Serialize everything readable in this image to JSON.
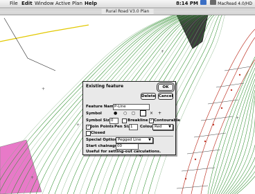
{
  "menubar": {
    "items": [
      "File",
      "Edit",
      "Window",
      "Active",
      "Plan",
      "Help"
    ],
    "clock": "8:14 PM",
    "disk_label": "MacRead 4.0/HD"
  },
  "window": {
    "title": "Rural Road V3.0 Plan"
  },
  "dialog": {
    "title": "Existing feature",
    "ok": "OK",
    "delete": "Delete",
    "cancel": "Cancel",
    "feature_name_label": "Feature Name",
    "feature_name_value": "P-Line",
    "symbol_label": "Symbol",
    "symbols": [
      "●",
      "○",
      "◻",
      "▢",
      "×",
      "+"
    ],
    "symbol_size_label": "Symbol Size",
    "symbol_size_value": "0",
    "breakline_label": "Breakline",
    "contourable_label": "Contourable",
    "join_points_label": "Join Points",
    "pen_size_label": "Pen Size:",
    "pen_size_value": "1",
    "colour_label": "Colour:",
    "colour_value": "Red",
    "closed_label": "Closed",
    "special_options_label": "Special Options:",
    "special_options_value": "Pegged Line",
    "start_chainage_label": "Start chainage:",
    "start_chainage_value": "00",
    "note": "Useful for setting-out calculations."
  },
  "colors": {
    "accent": "#e879c8",
    "contour": "#2f8f2f",
    "road": "#c0392b",
    "selection": "#ffffff"
  }
}
